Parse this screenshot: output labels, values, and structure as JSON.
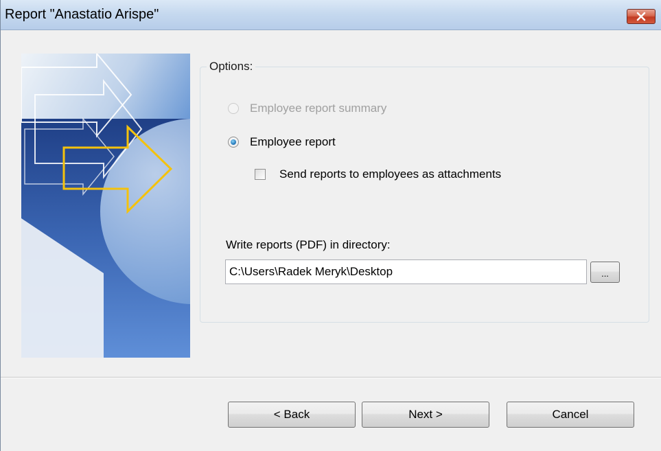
{
  "window": {
    "title": "Report \"Anastatio Arispe\"",
    "close_icon": "close-x-icon"
  },
  "banner": {
    "image": "wizard-arrows-banner"
  },
  "options": {
    "legend": "Options:",
    "radio_summary": {
      "label": "Employee report summary",
      "selected": false,
      "enabled": false
    },
    "radio_report": {
      "label": "Employee report",
      "selected": true,
      "enabled": true
    },
    "checkbox_attachments": {
      "label": "Send reports to employees as attachments",
      "checked": false
    },
    "directory": {
      "label": "Write reports (PDF) in directory:",
      "value": "C:\\Users\\Radek Meryk\\Desktop",
      "browse_label": "..."
    }
  },
  "buttons": {
    "back": "< Back",
    "next": "Next >",
    "cancel": "Cancel"
  },
  "colors": {
    "titlebar": "#c6d9ef",
    "close_button": "#c13a22",
    "banner_blue": "#2f5aa0",
    "arrow_yellow": "#f4c20d"
  }
}
